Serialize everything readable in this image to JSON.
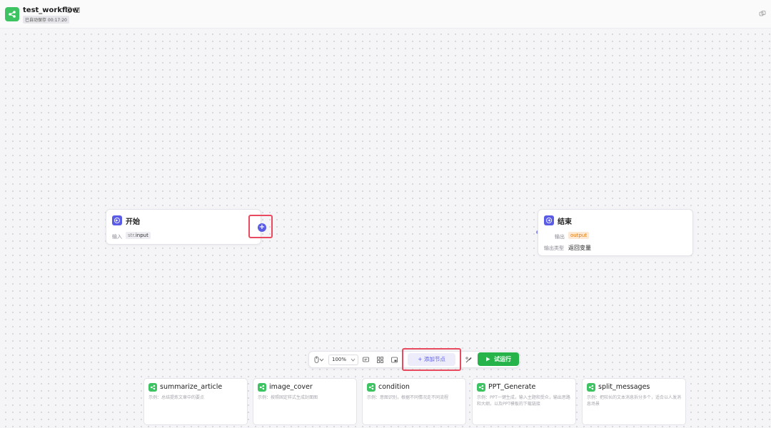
{
  "header": {
    "title": "test_workflow",
    "autosave": "已自动保存 00:17:20"
  },
  "nodes": {
    "start": {
      "title": "开始",
      "input_label": "输入",
      "var_type": "str.",
      "var_name": "input"
    },
    "end": {
      "title": "结束",
      "output_label": "输出",
      "output_var": "output",
      "output_type_label": "输出类型",
      "output_type_value": "返回变量"
    }
  },
  "toolbar": {
    "zoom": "100%",
    "add_node": "+ 添加节点",
    "run": "试运行"
  },
  "plugins": [
    {
      "name": "summarize_article",
      "desc": "示例：总结提炼文章中的要点"
    },
    {
      "name": "image_cover",
      "desc": "示例：按照固定样式生成封面图"
    },
    {
      "name": "condition",
      "desc": "示例：意图识别，根据不同情况走不同流程"
    },
    {
      "name": "PPT_Generate",
      "desc": "示例：PPT一键生成，输入主题和受众，输出思路和大纲，以及PPT模板的下载链接"
    },
    {
      "name": "split_messages",
      "desc": "示例：把较长的文本消息拆分多个，适合以人发消息场景"
    }
  ],
  "colors": {
    "accent": "#5b5ce6",
    "run_green": "#25b34a",
    "highlight_red": "#e84a5f",
    "plugin_green": "#3ec363"
  }
}
